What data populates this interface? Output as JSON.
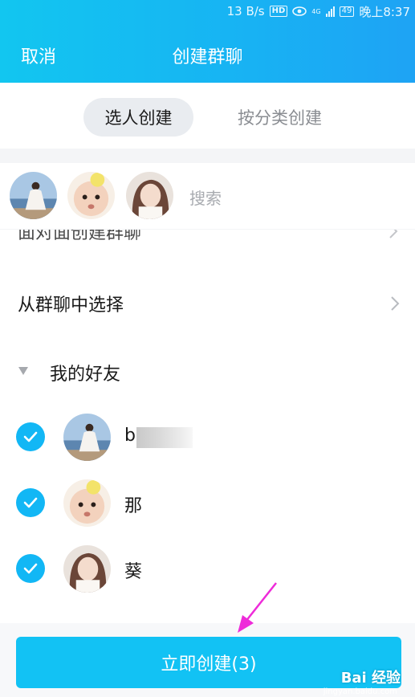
{
  "status_bar": {
    "speed": "13 B/s",
    "hd": "HD",
    "network": "4G",
    "battery": "49",
    "time": "晚上8:37"
  },
  "header": {
    "cancel_label": "取消",
    "title": "创建群聊",
    "background_colors": [
      "#12c6f0",
      "#1ea3f4"
    ]
  },
  "tabs": [
    {
      "label": "选人创建",
      "active": true
    },
    {
      "label": "按分类创建",
      "active": false
    }
  ],
  "selected": {
    "avatars": [
      "avatar-girl-sea",
      "avatar-baby",
      "avatar-girl-portrait"
    ],
    "search_placeholder": "搜索"
  },
  "list": {
    "cut_off_item": "面对面创建群聊",
    "group_item": "从群聊中选择",
    "section_title": "我的好友",
    "friends": [
      {
        "name": "b",
        "checked": true,
        "avatar": "avatar-girl-sea"
      },
      {
        "name": "那",
        "checked": true,
        "avatar": "avatar-baby"
      },
      {
        "name": "葵",
        "checked": true,
        "avatar": "avatar-girl-portrait"
      }
    ]
  },
  "create_button": {
    "label": "立即创建(3)",
    "color": "#12c2f4"
  },
  "watermark": {
    "text": "Bai 经验",
    "sub": "jingyan.baidu.com"
  },
  "accent_color": "#12b7f5",
  "annotation_arrow_color": "#ee2bd9"
}
